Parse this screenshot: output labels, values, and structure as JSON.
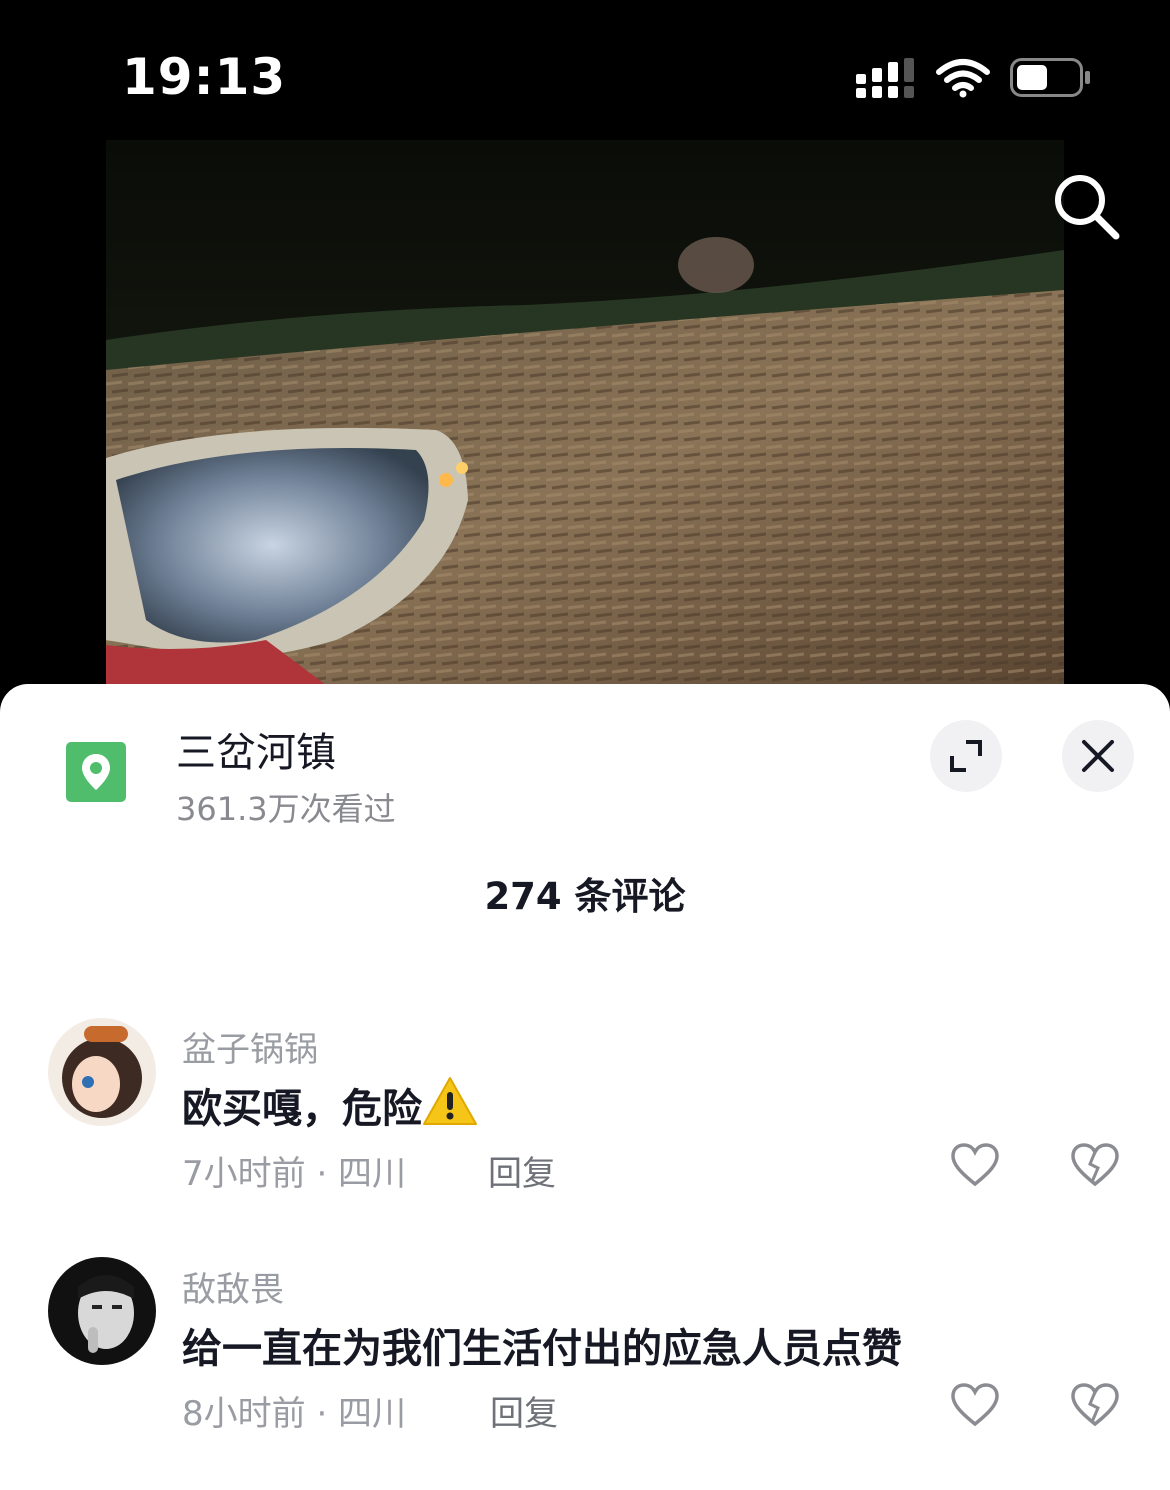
{
  "status_bar": {
    "time": "19:13"
  },
  "video": {
    "search_icon": "search-icon"
  },
  "location": {
    "icon": "location-pin-icon",
    "name": "三岔河镇",
    "views": "361.3万次看过"
  },
  "sheet_controls": {
    "expand_icon": "expand-icon",
    "close_icon": "close-icon"
  },
  "comments_header": {
    "count_label": "274 条评论"
  },
  "comments": [
    {
      "user": "盆子锅锅",
      "text": "欧买嘎，危险",
      "emoji": "warning-icon",
      "meta": "7小时前 · 四川",
      "reply": "回复"
    },
    {
      "user": "敌敌畏",
      "text": "给一直在为我们生活付出的应急人员点赞",
      "meta": "8小时前 · 四川",
      "reply": "回复"
    }
  ],
  "colors": {
    "location_green": "#4fbd6b",
    "text_primary": "#161823",
    "text_secondary": "#9a9ca3"
  }
}
